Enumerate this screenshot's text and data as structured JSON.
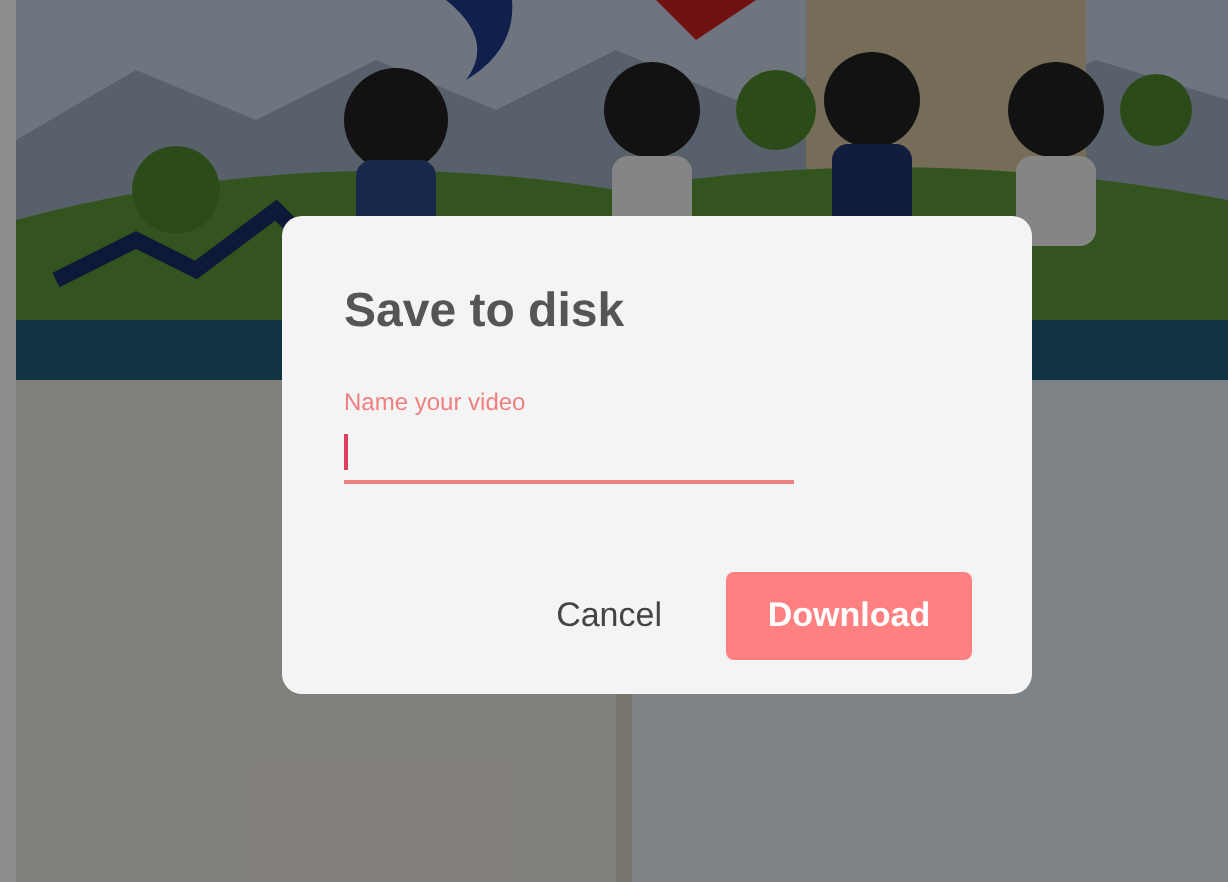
{
  "dialog": {
    "title": "Save to disk",
    "field": {
      "label": "Name your video",
      "focused": true
    },
    "buttons": [
      {
        "label": "Cancel",
        "kind": "text"
      },
      {
        "label": "Download",
        "kind": "primary"
      }
    ]
  }
}
